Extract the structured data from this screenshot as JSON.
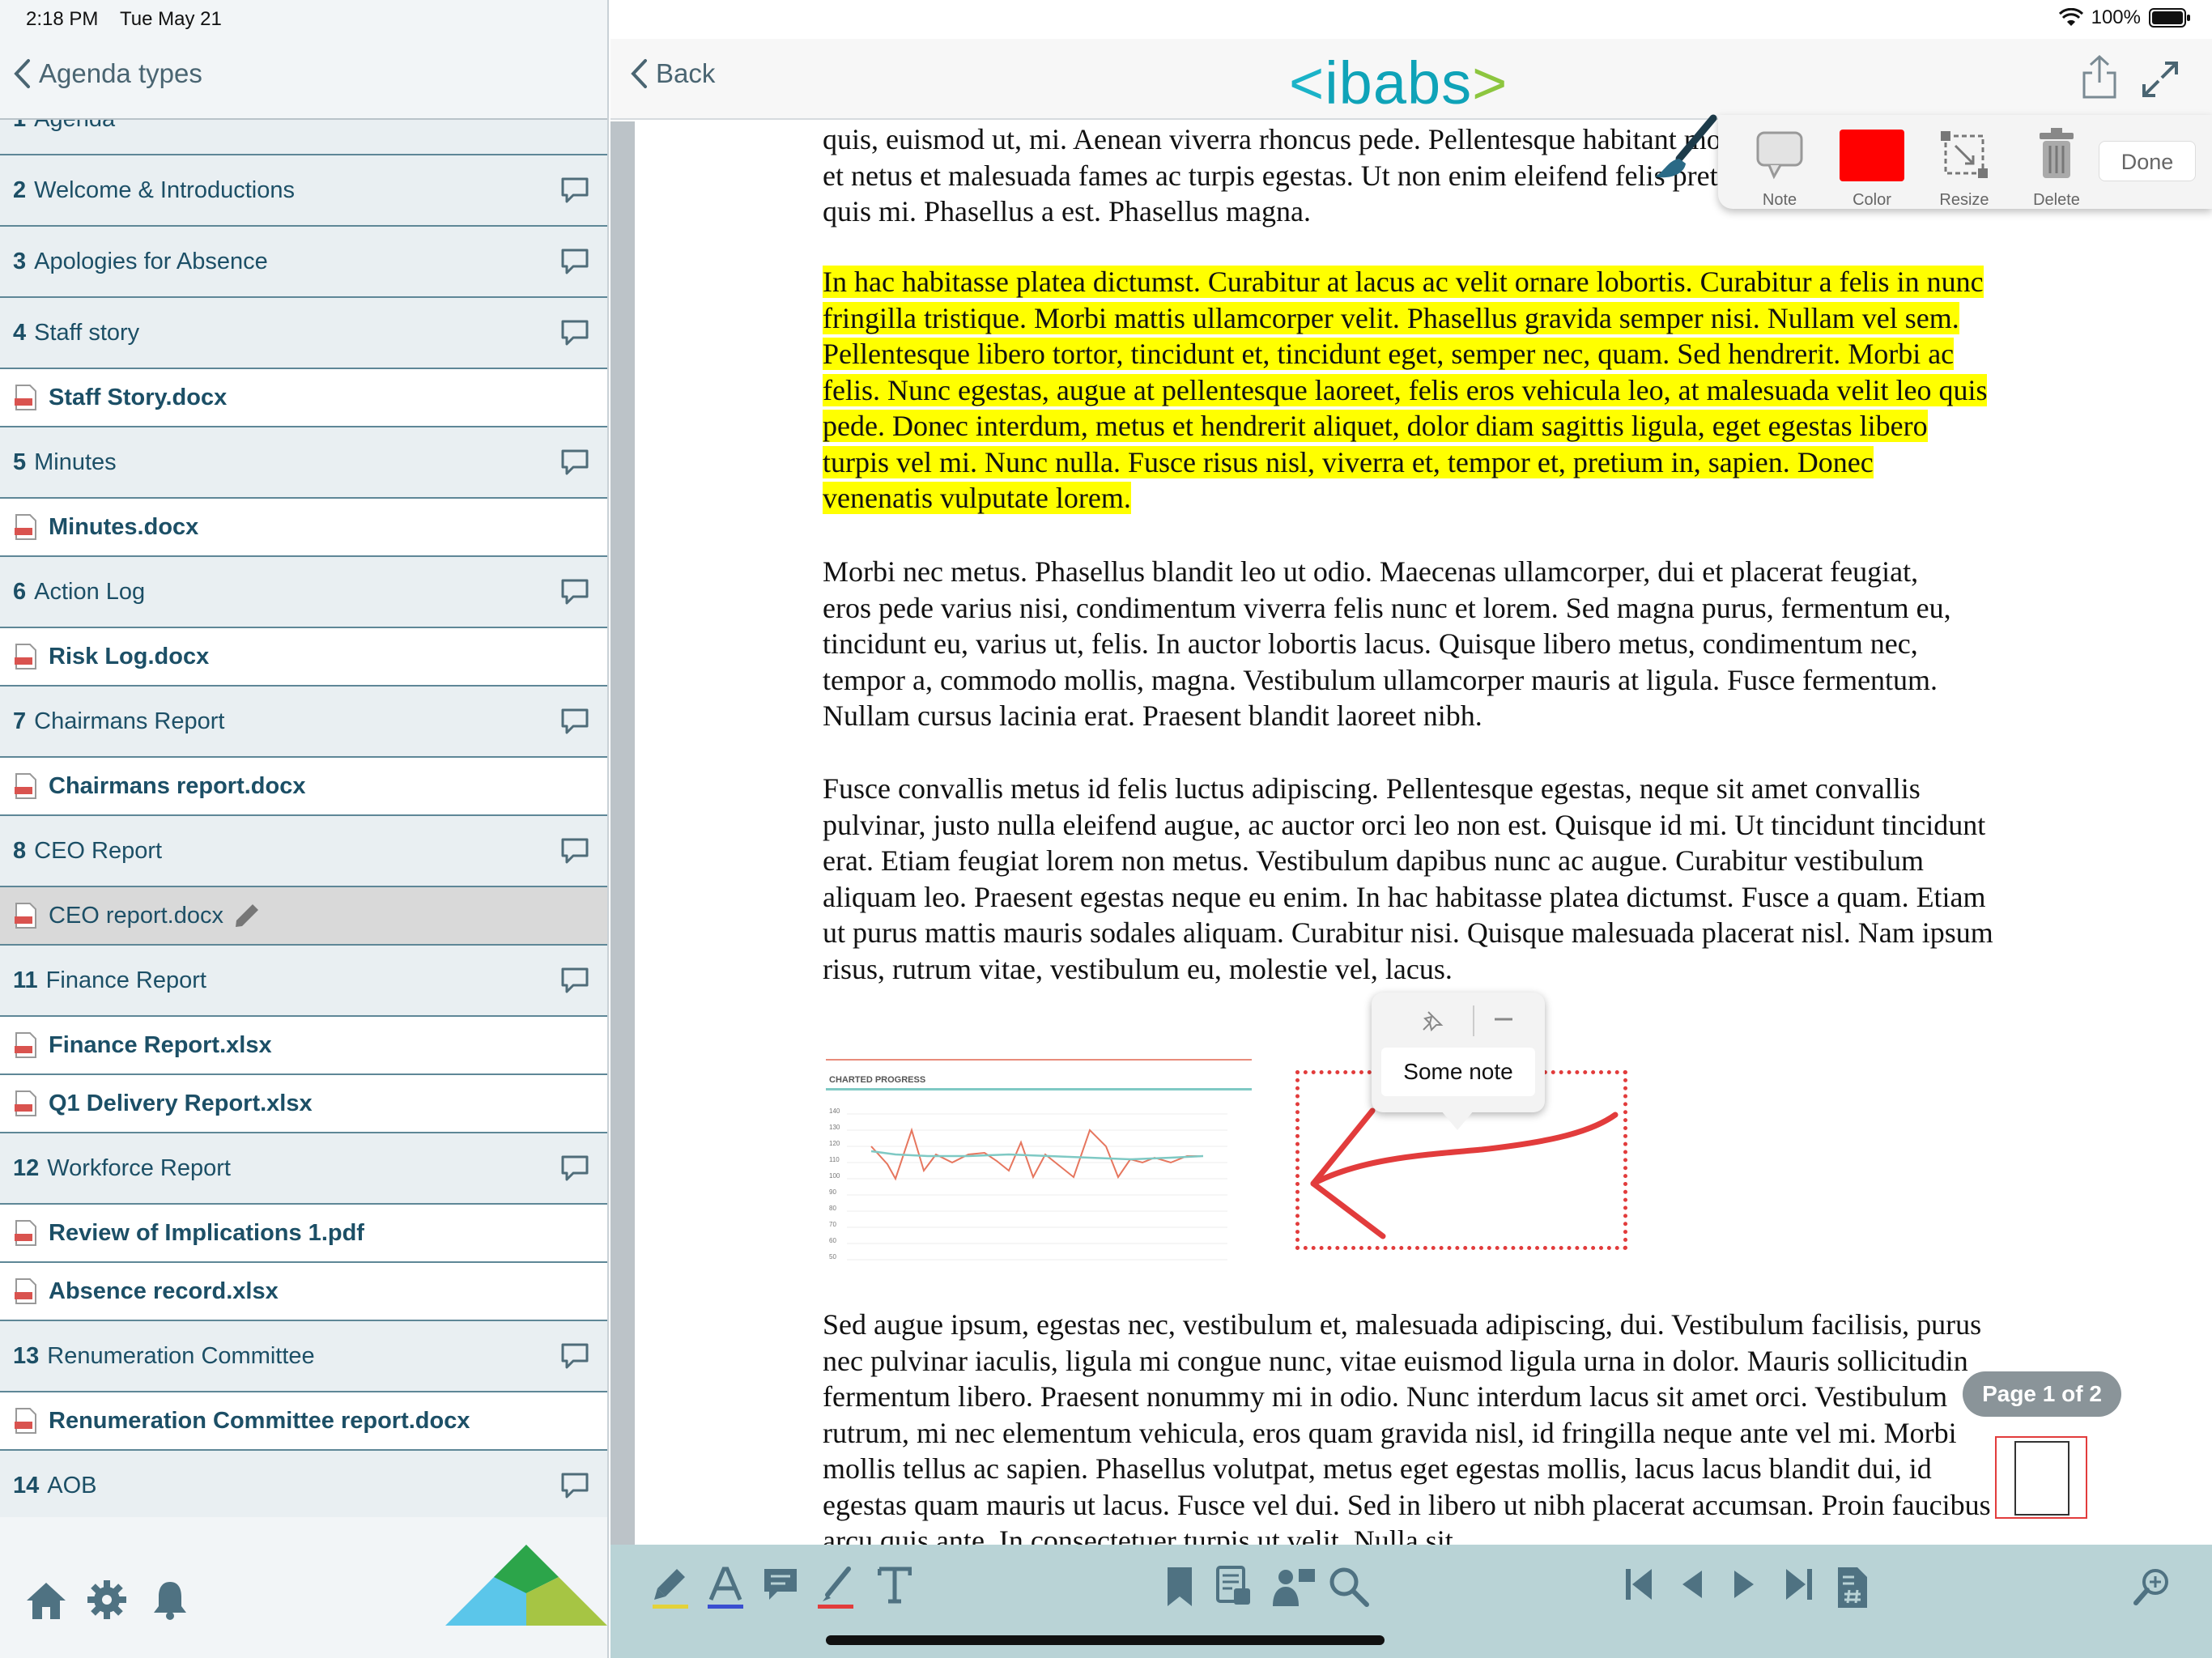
{
  "status": {
    "time": "2:18 PM",
    "date": "Tue May 21",
    "battery": "100%"
  },
  "sidebar": {
    "back_label": "Agenda types",
    "partial_item": {
      "num": "1",
      "title": "Agenda"
    },
    "items": [
      {
        "type": "agenda",
        "num": "2",
        "title": "Welcome & Introductions"
      },
      {
        "type": "agenda",
        "num": "3",
        "title": "Apologies for Absence"
      },
      {
        "type": "agenda",
        "num": "4",
        "title": "Staff story"
      },
      {
        "type": "doc",
        "title": "Staff Story.docx"
      },
      {
        "type": "agenda",
        "num": "5",
        "title": "Minutes"
      },
      {
        "type": "doc",
        "title": "Minutes.docx"
      },
      {
        "type": "agenda",
        "num": "6",
        "title": "Action Log"
      },
      {
        "type": "doc",
        "title": "Risk Log.docx"
      },
      {
        "type": "agenda",
        "num": "7",
        "title": "Chairmans Report"
      },
      {
        "type": "doc",
        "title": "Chairmans report.docx"
      },
      {
        "type": "agenda",
        "num": "8",
        "title": "CEO Report"
      },
      {
        "type": "doc",
        "title": "CEO report.docx",
        "selected": true
      },
      {
        "type": "agenda",
        "num": "11",
        "title": "Finance Report"
      },
      {
        "type": "doc",
        "title": "Finance Report.xlsx"
      },
      {
        "type": "doc",
        "title": "Q1 Delivery Report.xlsx"
      },
      {
        "type": "agenda",
        "num": "12",
        "title": "Workforce Report"
      },
      {
        "type": "doc",
        "title": "Review of Implications 1.pdf"
      },
      {
        "type": "doc",
        "title": "Absence record.xlsx"
      },
      {
        "type": "agenda",
        "num": "13",
        "title": "Renumeration Committee"
      },
      {
        "type": "doc",
        "title": "Renumeration Committee report.docx"
      },
      {
        "type": "agenda",
        "num": "14",
        "title": "AOB"
      }
    ]
  },
  "topbar": {
    "back_label": "Back",
    "logo": {
      "open": "<",
      "name": "ibabs",
      "close": ">"
    }
  },
  "annot_toolbar": {
    "note": "Note",
    "color": "Color",
    "resize": "Resize",
    "delete": "Delete",
    "done": "Done",
    "color_value": "#ff0000"
  },
  "document": {
    "p0": "quis, euismod ut, mi. Aenean viverra rhoncus pede. Pellentesque habitant morbi tristique senectus et netus et malesuada fames ac turpis egestas. Ut non enim eleifend felis pretium feugiat. Vivamus quis mi. Phasellus a est. Phasellus magna.",
    "p1": "In hac habitasse platea dictumst. Curabitur at lacus ac velit ornare lobortis. Curabitur a felis in nunc fringilla tristique. Morbi mattis ullamcorper velit. Phasellus gravida semper nisi. Nullam vel sem. Pellentesque libero tortor, tincidunt et, tincidunt eget, semper nec, quam. Sed hendrerit. Morbi ac felis. Nunc egestas, augue at pellentesque laoreet, felis eros vehicula leo, at malesuada velit leo quis pede. Donec interdum, metus et hendrerit aliquet, dolor diam sagittis ligula, eget egestas libero turpis vel mi. Nunc nulla. Fusce risus nisl, viverra et, tempor et, pretium in, sapien. Donec venenatis vulputate lorem.",
    "p2": "Morbi nec metus. Phasellus blandit leo ut odio. Maecenas ullamcorper, dui et placerat feugiat, eros pede varius nisi, condimentum viverra felis nunc et lorem. Sed magna purus, fermentum eu, tincidunt eu, varius ut, felis. In auctor lobortis lacus. Quisque libero metus, condimentum nec, tempor a, commodo mollis, magna. Vestibulum ullamcorper mauris at ligula. Fusce fermentum. Nullam cursus lacinia erat. Praesent blandit laoreet nibh.",
    "p3": "Fusce convallis metus id felis luctus adipiscing. Pellentesque egestas, neque sit amet convallis pulvinar, justo nulla eleifend augue, ac auctor orci leo non est. Quisque id mi. Ut tincidunt tincidunt erat. Etiam feugiat lorem non metus. Vestibulum dapibus nunc ac augue. Curabitur vestibulum aliquam leo. Praesent egestas neque eu enim. In hac habitasse platea dictumst. Fusce a quam. Etiam ut purus mattis mauris sodales aliquam. Curabitur nisi. Quisque malesuada placerat nisl. Nam ipsum risus, rutrum vitae, vestibulum eu, molestie vel, lacus.",
    "p4": "Sed augue ipsum, egestas nec, vestibulum et, malesuada adipiscing, dui. Vestibulum facilisis, purus nec pulvinar iaculis, ligula mi congue nunc, vitae euismod ligula urna in dolor. Mauris sollicitudin fermentum libero. Praesent nonummy mi in odio. Nunc interdum lacus sit amet orci. Vestibulum rutrum, mi nec elementum vehicula, eros quam gravida nisl, id fringilla neque ante vel mi. Morbi mollis tellus ac sapien. Phasellus volutpat, metus eget egestas mollis, lacus lacus blandit dui, id egestas quam mauris ut lacus. Fusce vel dui. Sed in libero ut nibh placerat accumsan. Proin faucibus arcu quis ante. In consectetuer turpis ut velit. Nulla sit",
    "chart": {
      "title": "CHARTED PROGRESS",
      "y_ticks": [
        "140",
        "130",
        "120",
        "110",
        "100",
        "90",
        "80",
        "70",
        "60",
        "50"
      ]
    }
  },
  "note": {
    "text": "Some note"
  },
  "page_indicator": "Page 1 of 2",
  "colors": {
    "accent": "#1c4f66",
    "highlight": "#ffff00",
    "annotation": "#e23c3c",
    "bottombar": "#b9d3d6"
  }
}
